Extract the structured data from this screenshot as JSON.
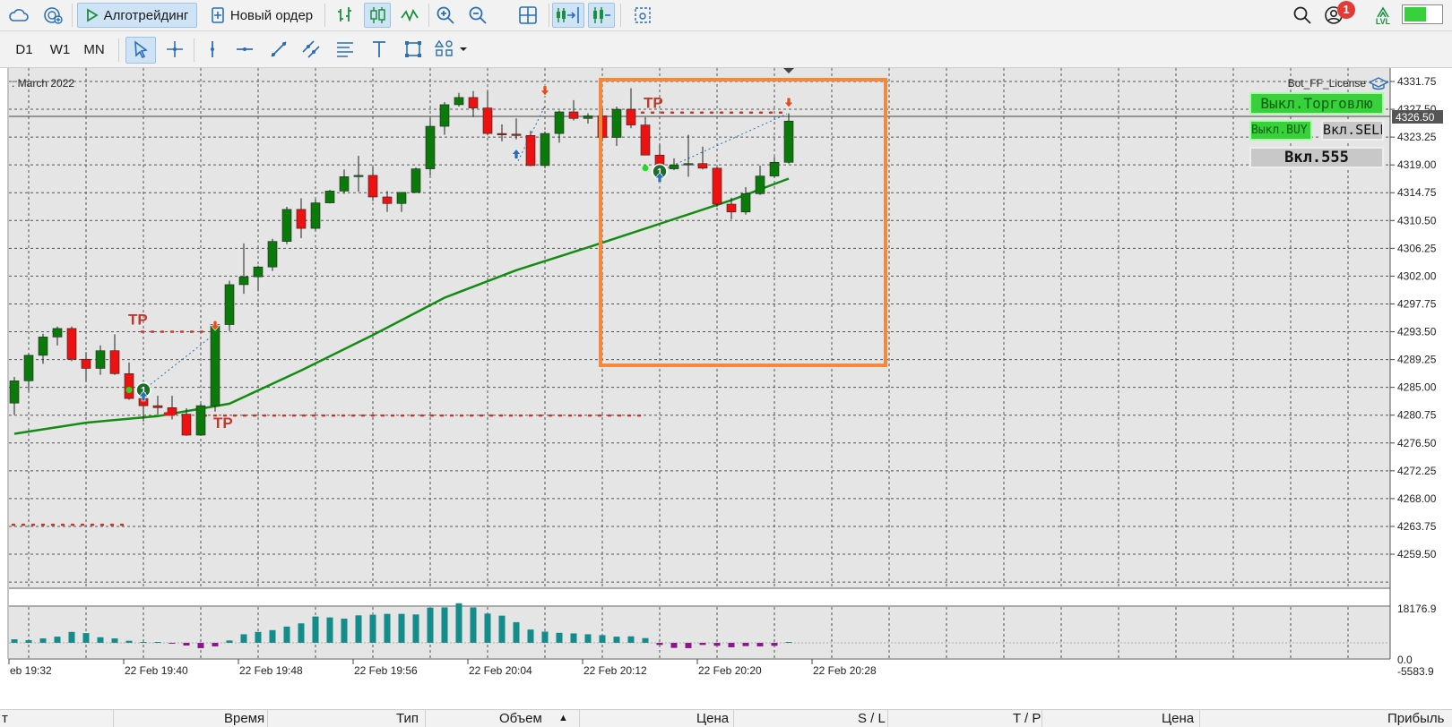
{
  "toolbar": {
    "algotrading_label": "Алготрейдинг",
    "new_order_label": "Новый ордер",
    "notifications_count": "1",
    "level_label": "LVL",
    "timeframes": [
      "D1",
      "W1",
      "MN"
    ]
  },
  "chart": {
    "header_text": ": March 2022",
    "expert_name": "Bot_FF_License",
    "current_price_label": "4326.50",
    "price_axis": [
      "4331.75",
      "4327.50",
      "4323.25",
      "4319.00",
      "4314.75",
      "4310.50",
      "4306.25",
      "4302.00",
      "4297.75",
      "4293.50",
      "4289.25",
      "4285.00",
      "4280.75",
      "4276.50",
      "4272.25",
      "4268.00",
      "4263.75",
      "4259.50"
    ],
    "indicator_axis": [
      "18176.9",
      "0.0",
      "-5583.9"
    ],
    "time_axis": [
      "eb 19:32",
      "22 Feb 19:40",
      "22 Feb 19:48",
      "22 Feb 19:56",
      "22 Feb 20:04",
      "22 Feb 20:12",
      "22 Feb 20:20",
      "22 Feb 20:28"
    ],
    "tp_label": "TP",
    "trade_numbers": [
      "1",
      "1"
    ],
    "panel_buttons": {
      "trading": "Выкл.Торговлю",
      "buy": "Выкл.BUY",
      "sell": "Вкл.SELL",
      "lot": "Вкл.555"
    },
    "colors": {
      "bull": "#0a7a0a",
      "bear": "#ee1111",
      "ma": "#148c14",
      "histogram_pos": "#148c8c",
      "histogram_neg": "#8c148c",
      "tp_line": "#c0392b",
      "highlight": "#f5883a"
    }
  },
  "chart_data": {
    "type": "candlestick",
    "candles": [
      {
        "o": 4282.6,
        "h": 4286.6,
        "l": 4280.8,
        "c": 4286.0
      },
      {
        "o": 4286.0,
        "h": 4290.1,
        "l": 4284.5,
        "c": 4289.9
      },
      {
        "o": 4289.9,
        "h": 4293.2,
        "l": 4288.6,
        "c": 4292.7
      },
      {
        "o": 4292.7,
        "h": 4294.3,
        "l": 4291.4,
        "c": 4294.0
      },
      {
        "o": 4294.0,
        "h": 4294.3,
        "l": 4289.0,
        "c": 4289.3
      },
      {
        "o": 4289.3,
        "h": 4290.4,
        "l": 4285.9,
        "c": 4287.9
      },
      {
        "o": 4287.9,
        "h": 4291.4,
        "l": 4286.9,
        "c": 4290.6
      },
      {
        "o": 4290.6,
        "h": 4293.1,
        "l": 4286.9,
        "c": 4287.1
      },
      {
        "o": 4287.1,
        "h": 4288.8,
        "l": 4283.1,
        "c": 4283.3
      },
      {
        "o": 4283.3,
        "h": 4284.7,
        "l": 4279.8,
        "c": 4282.2
      },
      {
        "o": 4282.2,
        "h": 4283.7,
        "l": 4280.8,
        "c": 4281.9
      },
      {
        "o": 4281.9,
        "h": 4283.7,
        "l": 4280.1,
        "c": 4280.9
      },
      {
        "o": 4280.9,
        "h": 4281.8,
        "l": 4277.6,
        "c": 4277.7
      },
      {
        "o": 4277.7,
        "h": 4282.5,
        "l": 4277.6,
        "c": 4282.2
      },
      {
        "o": 4282.2,
        "h": 4295.0,
        "l": 4281.3,
        "c": 4294.6
      },
      {
        "o": 4294.6,
        "h": 4301.3,
        "l": 4293.6,
        "c": 4300.7
      },
      {
        "o": 4300.7,
        "h": 4307.0,
        "l": 4299.3,
        "c": 4301.9
      },
      {
        "o": 4301.9,
        "h": 4303.6,
        "l": 4299.7,
        "c": 4303.4
      },
      {
        "o": 4303.4,
        "h": 4307.7,
        "l": 4302.8,
        "c": 4307.3
      },
      {
        "o": 4307.3,
        "h": 4312.6,
        "l": 4306.9,
        "c": 4312.2
      },
      {
        "o": 4312.2,
        "h": 4313.9,
        "l": 4307.8,
        "c": 4309.3
      },
      {
        "o": 4309.3,
        "h": 4313.7,
        "l": 4309.0,
        "c": 4313.2
      },
      {
        "o": 4313.2,
        "h": 4315.2,
        "l": 4313.1,
        "c": 4315.0
      },
      {
        "o": 4315.0,
        "h": 4318.3,
        "l": 4314.6,
        "c": 4317.2
      },
      {
        "o": 4317.2,
        "h": 4320.4,
        "l": 4314.9,
        "c": 4317.4
      },
      {
        "o": 4317.4,
        "h": 4318.7,
        "l": 4313.5,
        "c": 4314.1
      },
      {
        "o": 4314.1,
        "h": 4315.0,
        "l": 4311.8,
        "c": 4313.1
      },
      {
        "o": 4313.1,
        "h": 4314.6,
        "l": 4311.8,
        "c": 4314.8
      },
      {
        "o": 4314.8,
        "h": 4318.6,
        "l": 4314.7,
        "c": 4318.4
      },
      {
        "o": 4318.4,
        "h": 4326.1,
        "l": 4317.4,
        "c": 4324.9
      },
      {
        "o": 4324.9,
        "h": 4328.6,
        "l": 4323.6,
        "c": 4328.2
      },
      {
        "o": 4328.2,
        "h": 4330.0,
        "l": 4327.9,
        "c": 4329.3
      },
      {
        "o": 4329.3,
        "h": 4330.3,
        "l": 4326.3,
        "c": 4327.7
      },
      {
        "o": 4327.7,
        "h": 4330.3,
        "l": 4323.5,
        "c": 4323.8
      },
      {
        "o": 4323.8,
        "h": 4325.2,
        "l": 4322.6,
        "c": 4323.7
      },
      {
        "o": 4323.7,
        "h": 4326.1,
        "l": 4322.9,
        "c": 4323.5
      },
      {
        "o": 4323.5,
        "h": 4324.2,
        "l": 4318.8,
        "c": 4318.9
      },
      {
        "o": 4318.9,
        "h": 4324.1,
        "l": 4318.5,
        "c": 4323.8
      },
      {
        "o": 4323.8,
        "h": 4327.3,
        "l": 4322.4,
        "c": 4327.1
      },
      {
        "o": 4327.1,
        "h": 4328.9,
        "l": 4325.8,
        "c": 4326.1
      },
      {
        "o": 4326.1,
        "h": 4326.9,
        "l": 4325.3,
        "c": 4326.5
      },
      {
        "o": 4326.5,
        "h": 4327.6,
        "l": 4322.6,
        "c": 4323.2
      },
      {
        "o": 4323.2,
        "h": 4327.9,
        "l": 4321.9,
        "c": 4327.5
      },
      {
        "o": 4327.5,
        "h": 4330.7,
        "l": 4324.6,
        "c": 4325.1
      },
      {
        "o": 4325.1,
        "h": 4326.3,
        "l": 4320.5,
        "c": 4320.5
      },
      {
        "o": 4320.5,
        "h": 4322.2,
        "l": 4317.1,
        "c": 4318.4
      },
      {
        "o": 4318.4,
        "h": 4320.0,
        "l": 4318.2,
        "c": 4319.0
      },
      {
        "o": 4319.0,
        "h": 4323.6,
        "l": 4317.2,
        "c": 4319.2
      },
      {
        "o": 4319.2,
        "h": 4321.8,
        "l": 4318.3,
        "c": 4318.5
      },
      {
        "o": 4318.5,
        "h": 4318.7,
        "l": 4312.6,
        "c": 4313.0
      },
      {
        "o": 4313.0,
        "h": 4314.0,
        "l": 4310.7,
        "c": 4311.8
      },
      {
        "o": 4311.8,
        "h": 4315.6,
        "l": 4311.4,
        "c": 4314.6
      },
      {
        "o": 4314.6,
        "h": 4318.9,
        "l": 4314.4,
        "c": 4317.3
      },
      {
        "o": 4317.3,
        "h": 4320.2,
        "l": 4317.0,
        "c": 4319.4
      },
      {
        "o": 4319.4,
        "h": 4326.9,
        "l": 4319.2,
        "c": 4325.7
      }
    ],
    "ma": [
      {
        "i": 0,
        "v": 4277.9
      },
      {
        "i": 5,
        "v": 4279.6
      },
      {
        "i": 10,
        "v": 4280.6
      },
      {
        "i": 15,
        "v": 4282.5
      },
      {
        "i": 20,
        "v": 4287.6
      },
      {
        "i": 25,
        "v": 4293.0
      },
      {
        "i": 30,
        "v": 4298.7
      },
      {
        "i": 35,
        "v": 4302.9
      },
      {
        "i": 40,
        "v": 4306.4
      },
      {
        "i": 45,
        "v": 4310.0
      },
      {
        "i": 50,
        "v": 4313.6
      },
      {
        "i": 54,
        "v": 4316.9
      }
    ],
    "histogram": [
      1200,
      900,
      1500,
      2100,
      3700,
      3300,
      1900,
      1500,
      700,
      100,
      0,
      -200,
      -900,
      -1800,
      -1200,
      800,
      2900,
      3700,
      4300,
      5500,
      6600,
      8900,
      8600,
      8200,
      9300,
      9500,
      9800,
      9800,
      9600,
      11900,
      12000,
      13400,
      12000,
      9900,
      9200,
      7000,
      4500,
      3800,
      3400,
      3200,
      2900,
      2600,
      2100,
      2200,
      1600,
      -700,
      -1700,
      -1800,
      -700,
      -1000,
      -1500,
      -1100,
      -1200,
      -1000,
      300
    ],
    "x_labels": [
      "eb 19:32",
      "22 Feb 19:40",
      "22 Feb 19:48",
      "22 Feb 19:56",
      "22 Feb 20:04",
      "22 Feb 20:12",
      "22 Feb 20:20",
      "22 Feb 20:28"
    ],
    "price_range": [
      4257.0,
      4333.5
    ],
    "tp_levels": [
      4280.7,
      4293.5,
      4327.0,
      4264.0
    ]
  },
  "trade_panel": {
    "columns": [
      "т",
      "Время",
      "Тип",
      "Объем",
      "Цена",
      "S / L",
      "T / P",
      "Цена",
      "Прибыль"
    ]
  }
}
